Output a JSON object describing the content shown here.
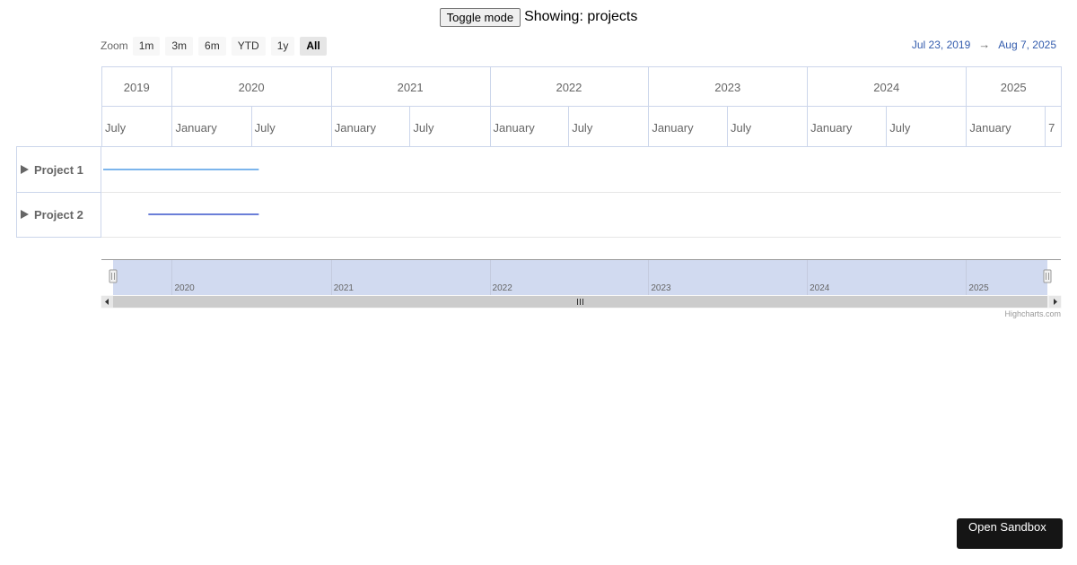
{
  "header": {
    "toggle_label": "Toggle mode",
    "mode_text": "Showing: projects"
  },
  "range_selector": {
    "zoom_label": "Zoom",
    "buttons": [
      "1m",
      "3m",
      "6m",
      "YTD",
      "1y",
      "All"
    ],
    "active": "All",
    "from": "Jul 23, 2019",
    "arrow": "→",
    "to": "Aug 7, 2025"
  },
  "chart_data": {
    "type": "gantt",
    "x_range": [
      "2019-07-23",
      "2025-08-07"
    ],
    "years": [
      "2019",
      "2020",
      "2021",
      "2022",
      "2023",
      "2024",
      "2025"
    ],
    "months": [
      "July",
      "January",
      "July",
      "January",
      "July",
      "January",
      "July",
      "January",
      "July",
      "January",
      "July",
      "January",
      "7"
    ],
    "series": [
      {
        "name": "Project 1",
        "start": "2019-07-23",
        "end": "2020-07-19",
        "color": "#7cb5ec"
      },
      {
        "name": "Project 2",
        "start": "2019-11-08",
        "end": "2020-07-19",
        "color": "#6b7fd8"
      }
    ],
    "navigator": {
      "labels": [
        "2020",
        "2021",
        "2022",
        "2023",
        "2024",
        "2025"
      ]
    }
  },
  "credits": "Highcharts.com",
  "sandbox_label": "Open Sandbox",
  "colors": {
    "grid": "#ccd6eb",
    "navigator_mask": "#d1daf0",
    "scrollbar": "#cccccc",
    "range_text": "#335cad"
  }
}
